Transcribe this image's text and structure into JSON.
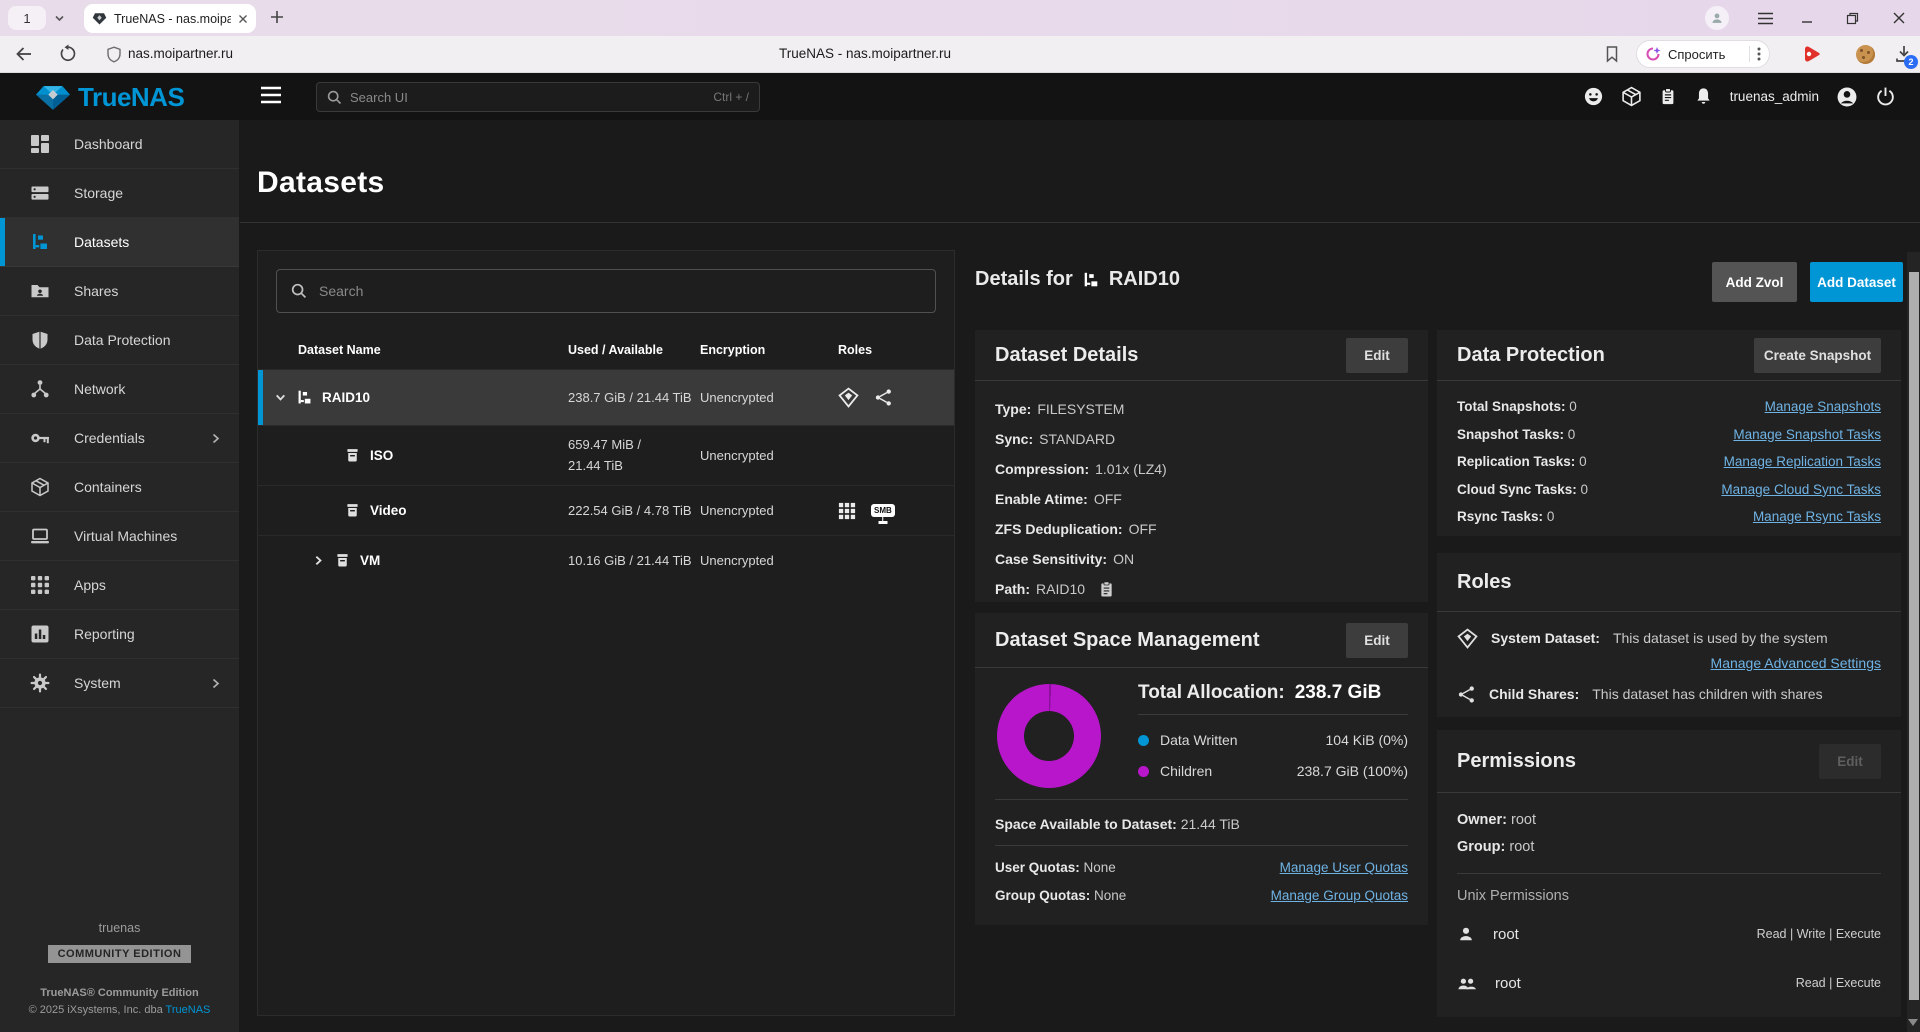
{
  "browser": {
    "tab_count": "1",
    "tab_title": "TrueNAS - nas.moipartn",
    "url": "nas.moipartner.ru",
    "page_title": "TrueNAS - nas.moipartner.ru",
    "ask_button": "Спросить",
    "download_badge": "2"
  },
  "header": {
    "brand": "TrueNAS",
    "search_placeholder": "Search UI",
    "search_shortcut": "Ctrl + /",
    "username": "truenas_admin"
  },
  "sidebar": {
    "items": [
      {
        "label": "Dashboard"
      },
      {
        "label": "Storage"
      },
      {
        "label": "Datasets",
        "active": true
      },
      {
        "label": "Shares"
      },
      {
        "label": "Data Protection"
      },
      {
        "label": "Network"
      },
      {
        "label": "Credentials",
        "chevron": true
      },
      {
        "label": "Containers"
      },
      {
        "label": "Virtual Machines"
      },
      {
        "label": "Apps"
      },
      {
        "label": "Reporting"
      },
      {
        "label": "System",
        "chevron": true
      }
    ],
    "footer": {
      "hostname": "truenas",
      "edition_badge": "COMMUNITY EDITION",
      "product": "TrueNAS® Community Edition",
      "copyright_prefix": "© 2025 iXsystems, Inc. dba ",
      "copyright_link": "TrueNAS"
    }
  },
  "page": {
    "title": "Datasets",
    "search_placeholder": "Search",
    "table": {
      "columns": [
        "Dataset Name",
        "Used / Available",
        "Encryption",
        "Roles"
      ],
      "rows": [
        {
          "name": "RAID10",
          "used": "238.7 GiB / 21.44 TiB",
          "encryption": "Unencrypted",
          "selected": true
        },
        {
          "name": "ISO",
          "used_line1": "659.47 MiB /",
          "used_line2": "21.44 TiB",
          "encryption": "Unencrypted"
        },
        {
          "name": "Video",
          "used": "222.54 GiB / 4.78 TiB",
          "encryption": "Unencrypted",
          "smb_label": "SMB"
        },
        {
          "name": "VM",
          "used": "10.16 GiB / 21.44 TiB",
          "encryption": "Unencrypted"
        }
      ]
    }
  },
  "details": {
    "title_prefix": "Details for",
    "dataset_name": "RAID10",
    "add_zvol": "Add Zvol",
    "add_dataset": "Add Dataset",
    "dataset_details": {
      "title": "Dataset Details",
      "edit": "Edit",
      "rows": [
        {
          "label": "Type:",
          "value": "FILESYSTEM"
        },
        {
          "label": "Sync:",
          "value": "STANDARD"
        },
        {
          "label": "Compression:",
          "value": "1.01x (LZ4)"
        },
        {
          "label": "Enable Atime:",
          "value": "OFF"
        },
        {
          "label": "ZFS Deduplication:",
          "value": "OFF"
        },
        {
          "label": "Case Sensitivity:",
          "value": "ON"
        },
        {
          "label": "Path:",
          "value": "RAID10"
        }
      ]
    },
    "data_protection": {
      "title": "Data Protection",
      "button": "Create Snapshot",
      "rows": [
        {
          "label": "Total Snapshots:",
          "value": "0",
          "link": "Manage Snapshots"
        },
        {
          "label": "Snapshot Tasks:",
          "value": "0",
          "link": "Manage Snapshot Tasks"
        },
        {
          "label": "Replication Tasks:",
          "value": "0",
          "link": "Manage Replication Tasks"
        },
        {
          "label": "Cloud Sync Tasks:",
          "value": "0",
          "link": "Manage Cloud Sync Tasks"
        },
        {
          "label": "Rsync Tasks:",
          "value": "0",
          "link": "Manage Rsync Tasks"
        }
      ]
    },
    "roles": {
      "title": "Roles",
      "system_dataset_label": "System Dataset:",
      "system_dataset_text": "This dataset is used by the system",
      "advanced_link": "Manage Advanced Settings",
      "child_shares_label": "Child Shares:",
      "child_shares_text": "This dataset has children with shares"
    },
    "space": {
      "title": "Dataset Space Management",
      "edit": "Edit",
      "total_label": "Total Allocation:",
      "total_value": "238.7 GiB",
      "legend": [
        {
          "label": "Data Written",
          "value": "104 KiB (0%)",
          "color": "#0095d5"
        },
        {
          "label": "Children",
          "value": "238.7 GiB (100%)",
          "color": "#b816cb"
        }
      ],
      "available_label": "Space Available to Dataset:",
      "available_value": "21.44 TiB",
      "quota_rows": [
        {
          "label": "User Quotas:",
          "value": "None",
          "link": "Manage User Quotas"
        },
        {
          "label": "Group Quotas:",
          "value": "None",
          "link": "Manage Group Quotas"
        }
      ]
    },
    "permissions": {
      "title": "Permissions",
      "edit": "Edit",
      "owner_label": "Owner:",
      "owner_value": "root",
      "group_label": "Group:",
      "group_value": "root",
      "section_title": "Unix Permissions",
      "entries": [
        {
          "name": "root",
          "perms": "Read | Write | Execute"
        },
        {
          "name": "root",
          "perms": "Read | Execute"
        }
      ]
    }
  },
  "colors": {
    "accent_blue": "#0095d5",
    "link_blue": "#6fb3e5",
    "children_magenta": "#b816cb",
    "selected_row": "#3a3a3a"
  }
}
